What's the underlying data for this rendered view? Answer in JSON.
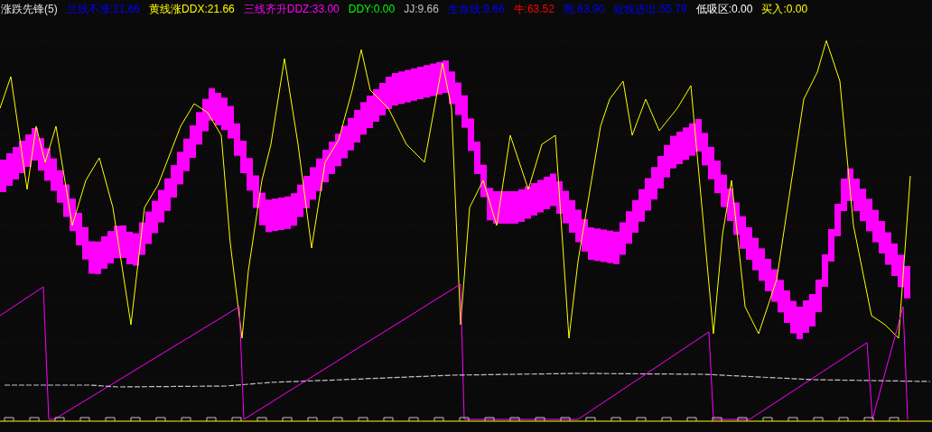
{
  "title": "涨跌先锋(5)",
  "legend": [
    {
      "text": "兰线不涨:21.66",
      "color": "#0000ff"
    },
    {
      "text": "黄线涨DDX:21.66",
      "color": "#ffff00"
    },
    {
      "text": "三线齐升DDZ:33.00",
      "color": "#ff00ff"
    },
    {
      "text": "DDY:0.00",
      "color": "#00ff00"
    },
    {
      "text": "JJ:9.66",
      "color": "#c0c0c0"
    },
    {
      "text": "生命线:9.66",
      "color": "#0000ff"
    },
    {
      "text": "牛:63.52",
      "color": "#ff0000"
    },
    {
      "text": "熊:63.90",
      "color": "#0000ff"
    },
    {
      "text": "短线进出:55.79",
      "color": "#0000ff"
    },
    {
      "text": "低吸区:0.00",
      "color": "#ffffff"
    },
    {
      "text": "买入:0.00",
      "color": "#ffff00"
    }
  ]
}
